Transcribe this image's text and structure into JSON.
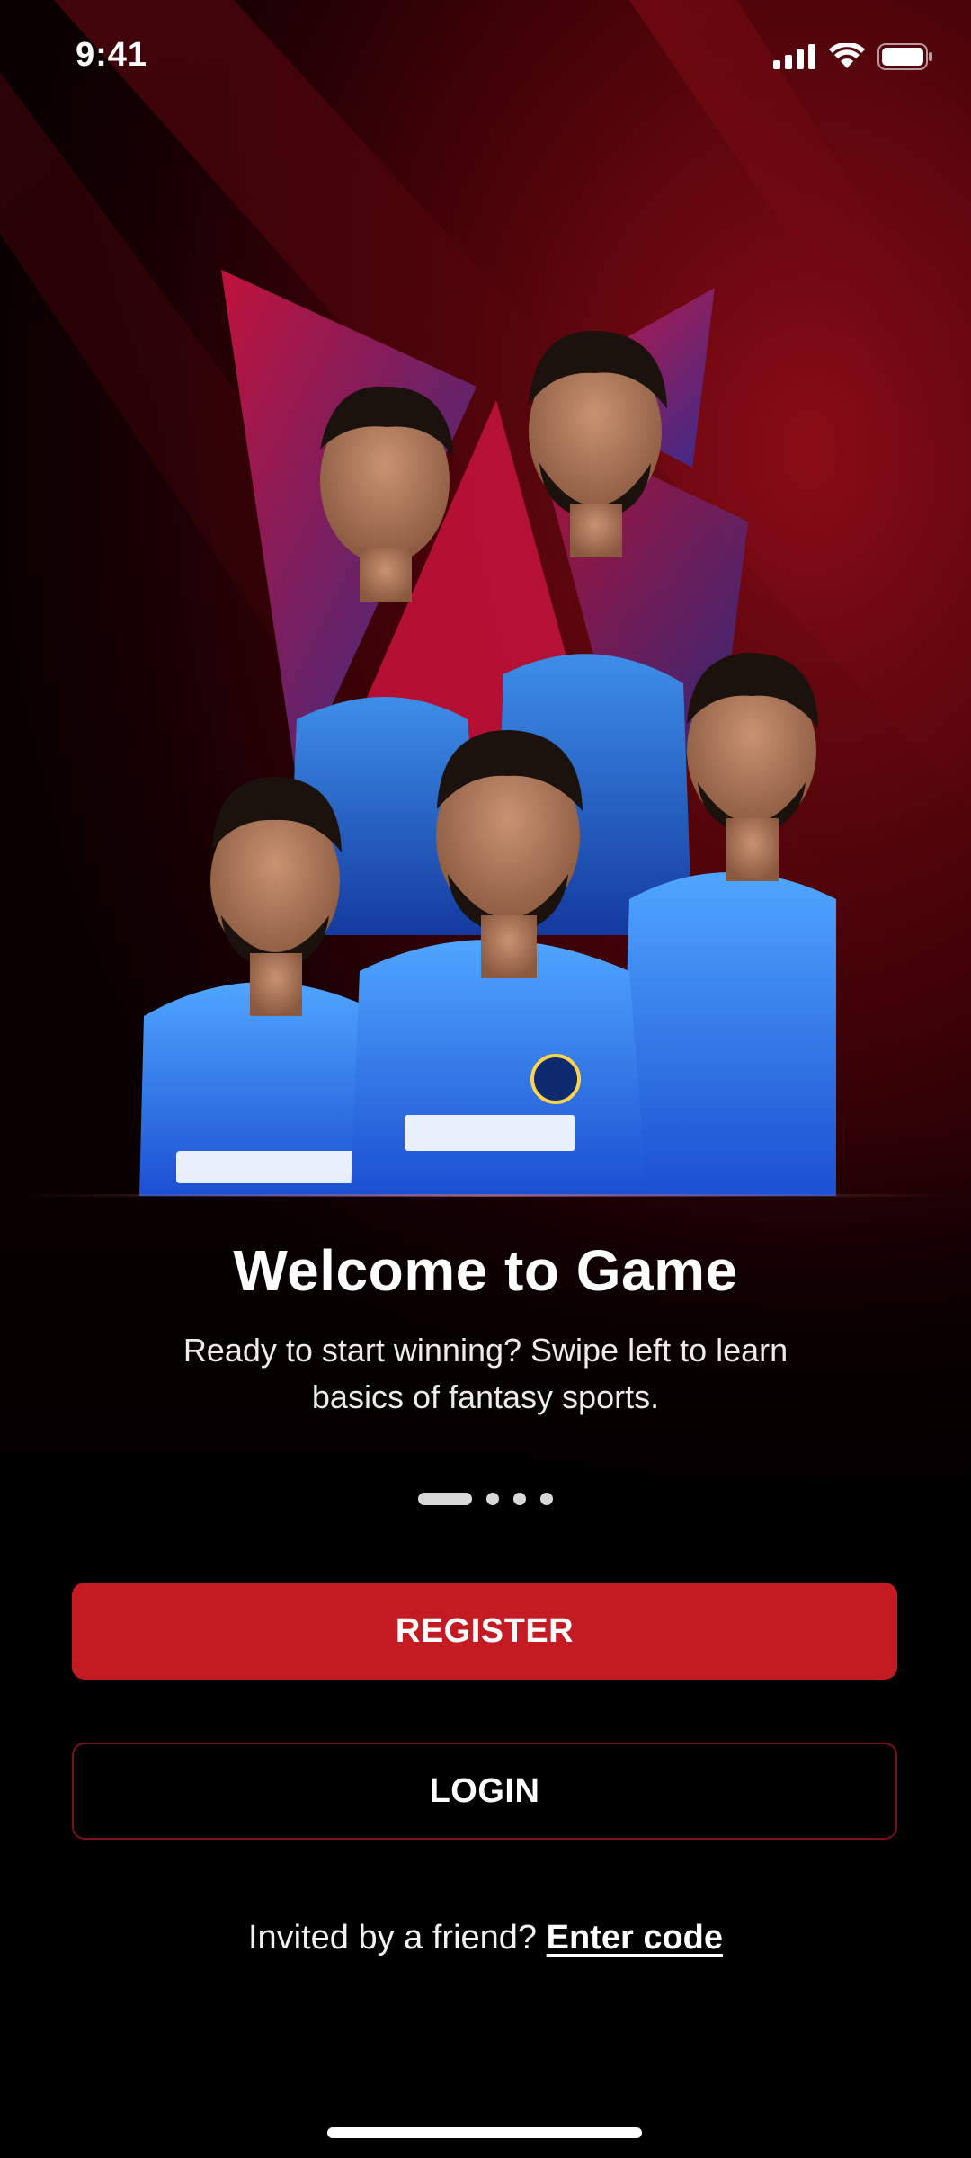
{
  "status_bar": {
    "time": "9:41",
    "icons": [
      "signal-icon",
      "wifi-icon",
      "battery-icon"
    ]
  },
  "hero": {
    "image_description_icon": "team-players-artwork"
  },
  "welcome": {
    "title": "Welcome to Game",
    "subtitle": "Ready to start winning? Swipe left to learn basics of fantasy sports."
  },
  "pager": {
    "total_pages": 4,
    "active_page": 1
  },
  "actions": {
    "register_label": "REGISTER",
    "login_label": "LOGIN"
  },
  "invite": {
    "prompt": "Invited by a friend?",
    "link_label": "Enter code"
  },
  "colors": {
    "accent": "#c41b22",
    "login_border": "#7a1018",
    "background_dark": "#000000",
    "background_red": "#8a0c17"
  }
}
